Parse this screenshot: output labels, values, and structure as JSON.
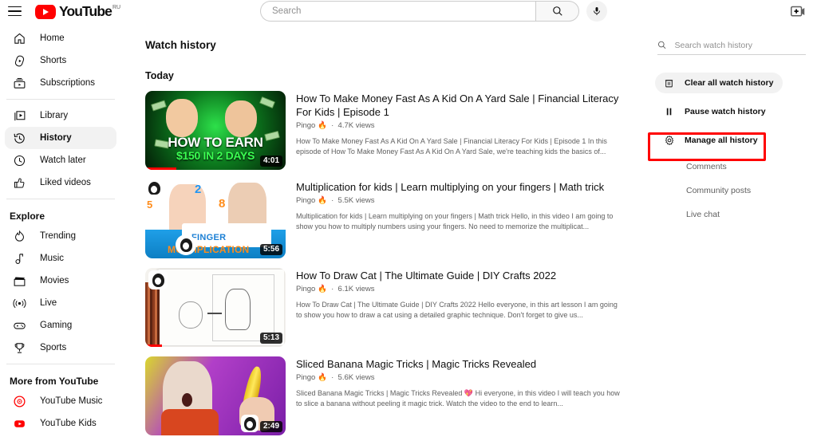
{
  "header": {
    "menu_icon": "hamburger-icon",
    "logo_text": "YouTube",
    "logo_superscript": "RU",
    "search_placeholder": "Search",
    "search_value": "",
    "search_icon": "search-icon",
    "mic_icon": "microphone-icon",
    "create_icon": "create-video-icon"
  },
  "sidebar": {
    "primary": [
      {
        "label": "Home",
        "icon": "home-icon",
        "active": false
      },
      {
        "label": "Shorts",
        "icon": "shorts-icon",
        "active": false
      },
      {
        "label": "Subscriptions",
        "icon": "subscriptions-icon",
        "active": false
      }
    ],
    "library": [
      {
        "label": "Library",
        "icon": "library-icon",
        "active": false
      },
      {
        "label": "History",
        "icon": "history-icon",
        "active": true
      },
      {
        "label": "Watch later",
        "icon": "clock-icon",
        "active": false
      },
      {
        "label": "Liked videos",
        "icon": "thumbs-up-icon",
        "active": false
      }
    ],
    "explore_header": "Explore",
    "explore": [
      {
        "label": "Trending",
        "icon": "trending-icon"
      },
      {
        "label": "Music",
        "icon": "music-note-icon"
      },
      {
        "label": "Movies",
        "icon": "clapperboard-icon"
      },
      {
        "label": "Live",
        "icon": "live-broadcast-icon"
      },
      {
        "label": "Gaming",
        "icon": "gamepad-icon"
      },
      {
        "label": "Sports",
        "icon": "trophy-icon"
      }
    ],
    "more_header": "More from YouTube",
    "more": [
      {
        "label": "YouTube Music",
        "icon": "youtube-music-icon"
      },
      {
        "label": "YouTube Kids",
        "icon": "youtube-kids-icon"
      }
    ]
  },
  "main": {
    "page_title": "Watch history",
    "day_header": "Today",
    "videos": [
      {
        "title": "How To Make Money Fast As A Kid On A Yard Sale | Financial Literacy For Kids | Episode 1",
        "channel": "Pingo",
        "channel_badge": "🔥",
        "views": "4.7K views",
        "description": "How To Make Money Fast As A Kid On A Yard Sale | Financial Literacy For Kids | Episode 1 In this episode of How To Make Money Fast As A Kid On A Yard Sale, we're teaching kids the basics of...",
        "duration": "4:01",
        "thumb_text_top": "HOW TO EARN",
        "thumb_text_bottom": "$150 IN 2 DAYS",
        "progress_percent": 22
      },
      {
        "title": "Multiplication for kids | Learn multiplying on your fingers | Math trick",
        "channel": "Pingo",
        "channel_badge": "🔥",
        "views": "5.5K views",
        "description": "Multiplication for kids | Learn multiplying on your fingers | Math trick Hello, in this video I am going to show you how to multiply numbers using your fingers. No need to memorize the multiplicat...",
        "duration": "5:56",
        "thumb_text_top": "FINGER",
        "thumb_text_bottom": "MULTIPLICATION",
        "progress_percent": 0
      },
      {
        "title": "How To Draw Cat | The Ultimate Guide | DIY Crafts 2022",
        "channel": "Pingo",
        "channel_badge": "🔥",
        "views": "6.1K views",
        "description": "How To Draw Cat | The Ultimate Guide | DIY Crafts 2022 Hello everyone, in this art lesson I am going to show you how to draw a cat using a detailed graphic technique. Don't forget to give us...",
        "duration": "5:13",
        "thumb_text_top": "",
        "thumb_text_bottom": "",
        "progress_percent": 12
      },
      {
        "title": "Sliced Banana Magic Tricks | Magic Tricks Revealed",
        "channel": "Pingo",
        "channel_badge": "🔥",
        "views": "5.6K views",
        "description": "Sliced Banana Magic Tricks | Magic Tricks Revealed 💖 Hi everyone, in this video I will teach you how to slice a banana without peeling it magic trick. Watch the video to the end to learn...",
        "duration": "2:49",
        "thumb_text_top": "",
        "thumb_text_bottom": "",
        "progress_percent": 0
      }
    ]
  },
  "right_panel": {
    "search_placeholder": "Search watch history",
    "search_value": "",
    "search_icon": "search-icon",
    "actions": [
      {
        "label": "Clear all watch history",
        "icon": "trash-icon",
        "filled": true
      },
      {
        "label": "Pause watch history",
        "icon": "pause-icon",
        "filled": false
      },
      {
        "label": "Manage all history",
        "icon": "gear-icon",
        "filled": false,
        "highlighted": true
      }
    ],
    "sub_items": [
      {
        "label": "Comments"
      },
      {
        "label": "Community posts"
      },
      {
        "label": "Live chat"
      }
    ],
    "highlight_color": "#ff0000"
  }
}
